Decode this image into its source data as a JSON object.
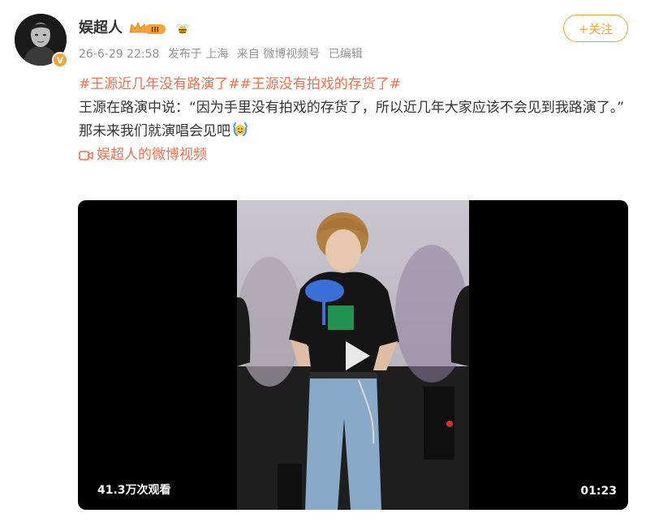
{
  "post": {
    "author": {
      "name": "娱超人",
      "vip_level": "III"
    },
    "meta": {
      "date": "26-6-29 22:58",
      "posted_from": "发布于 上海",
      "source": "来自 微博视频号",
      "edited": "已编辑"
    },
    "follow_label": "+关注",
    "topics": [
      "#王源近几年没有路演了#",
      "#王源没有拍戏的存货了#"
    ],
    "line1": "王源在路演中说：“因为手里没有拍戏的存货了，所以近几年大家应该不会见到我路演了。”",
    "line2": "那未来我们就演唱会见吧",
    "video_link": "娱超人的微博视频"
  },
  "video": {
    "views": "41.3万次观看",
    "duration": "01:23"
  },
  "icons": {
    "vip": "vip-crown-icon",
    "bee": "bee-badge-icon",
    "camera": "video-camera-icon",
    "emoji": "celebrate-emoji-icon",
    "play": "play-icon",
    "verified": "verified-badge-icon"
  },
  "colors": {
    "accent": "#f7a234",
    "link": "#eb7350",
    "meta": "#939393",
    "text": "#333333"
  }
}
